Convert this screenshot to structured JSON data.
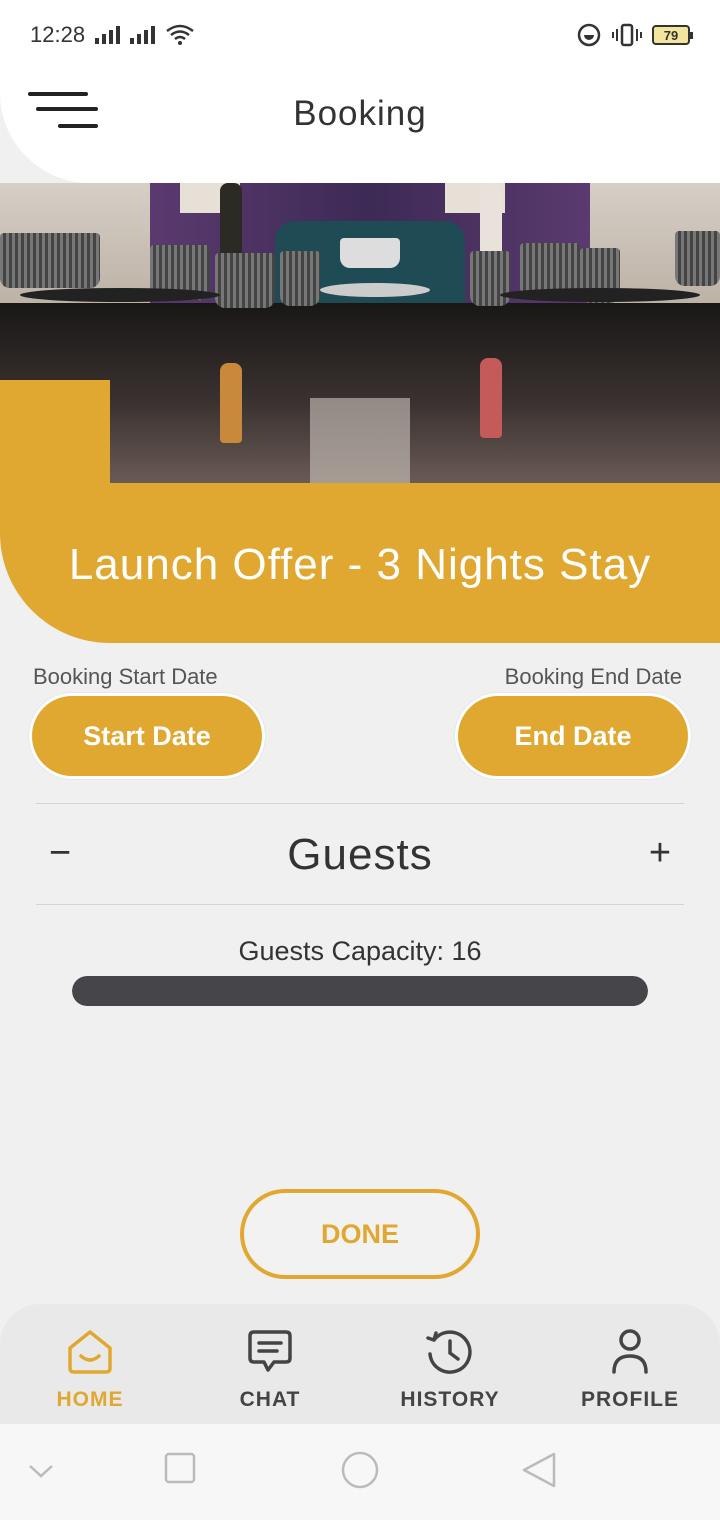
{
  "status_bar": {
    "time": "12:28",
    "battery_level": "79"
  },
  "header": {
    "title": "Booking"
  },
  "offer": {
    "title": "Launch Offer - 3 Nights Stay"
  },
  "booking": {
    "start_label": "Booking Start Date",
    "start_button": "Start Date",
    "end_label": "Booking End Date",
    "end_button": "End Date"
  },
  "guests": {
    "minus": "−",
    "label": "Guests",
    "plus": "+",
    "capacity_text": "Guests Capacity: 16",
    "capacity_fill_fraction": 1.0
  },
  "actions": {
    "done_label": "DONE"
  },
  "bottom_nav": {
    "items": [
      {
        "label": "HOME",
        "icon": "home-icon",
        "active": true
      },
      {
        "label": "CHAT",
        "icon": "chat-icon",
        "active": false
      },
      {
        "label": "HISTORY",
        "icon": "history-icon",
        "active": false
      },
      {
        "label": "PROFILE",
        "icon": "profile-icon",
        "active": false
      }
    ]
  },
  "colors": {
    "accent": "#e0a830",
    "dark": "#45454a",
    "background": "#f0f0f0"
  }
}
